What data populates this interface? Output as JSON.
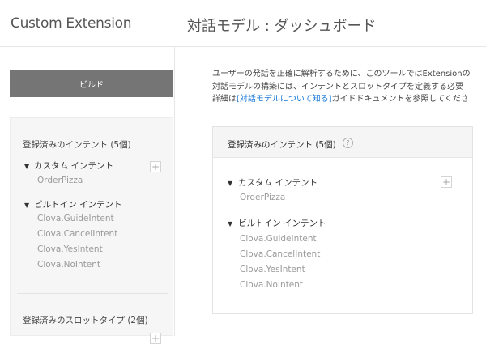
{
  "header": {
    "app_title": "Custom Extension",
    "page_title": "対話モデル : ダッシュボード"
  },
  "sidebar": {
    "build_label": "ビルド",
    "intents_heading": "登録済みのインテント (5個)",
    "custom_group": "カスタム インテント",
    "custom_items": [
      "OrderPizza"
    ],
    "builtin_group": "ビルトイン インテント",
    "builtin_items": [
      "Clova.GuideIntent",
      "Clova.CancelIntent",
      "Clova.YesIntent",
      "Clova.NoIntent"
    ],
    "slots_heading": "登録済みのスロットタイプ (2個)"
  },
  "main": {
    "desc_line1": "ユーザーの発話を正確に解析するために、このツールではExtensionの",
    "desc_line2": "対話モデルの構築には、インテントとスロットタイプを定義する必要",
    "desc_line3_pre": "詳細は",
    "desc_link": "[対話モデルについて知る]",
    "desc_line3_post": "ガイドドキュメントを参照してくださ",
    "panel_heading": "登録済みのインテント (5個)",
    "custom_group": "カスタム インテント",
    "custom_items": [
      "OrderPizza"
    ],
    "builtin_group": "ビルトイン インテント",
    "builtin_items": [
      "Clova.GuideIntent",
      "Clova.CancelIntent",
      "Clova.YesIntent",
      "Clova.NoIntent"
    ]
  },
  "icons": {
    "expand": "▼",
    "add": "+",
    "help": "?"
  },
  "colors": {
    "build_button_bg": "#757575",
    "link": "#1a7ad9",
    "muted_item": "#9a9a9a"
  }
}
